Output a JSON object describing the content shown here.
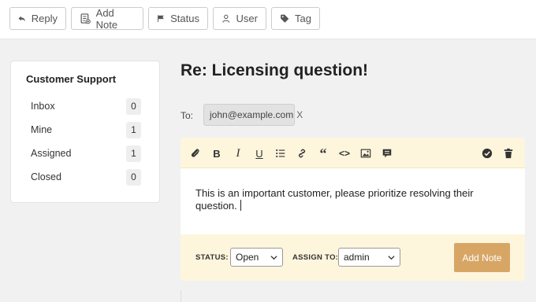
{
  "toolbar": {
    "reply": "Reply",
    "add_note": "Add Note",
    "status": "Status",
    "user": "User",
    "tag": "Tag"
  },
  "sidebar": {
    "title": "Customer Support",
    "items": [
      {
        "label": "Inbox",
        "count": "0"
      },
      {
        "label": "Mine",
        "count": "1"
      },
      {
        "label": "Assigned",
        "count": "1"
      },
      {
        "label": "Closed",
        "count": "0"
      }
    ]
  },
  "ticket": {
    "title": "Re: Licensing question!",
    "to_label": "To:",
    "to_email": "john@example.com",
    "to_remove": "X"
  },
  "editor": {
    "body_text": "This is an important customer, please prioritize resolving their question.",
    "status_label": "STATUS:",
    "status_value": "Open",
    "assign_label": "ASSIGN TO:",
    "assign_value": "admin",
    "add_note_button": "Add Note"
  },
  "colors": {
    "accent": "#d7a665",
    "editor_bar": "#fdf5dc"
  }
}
